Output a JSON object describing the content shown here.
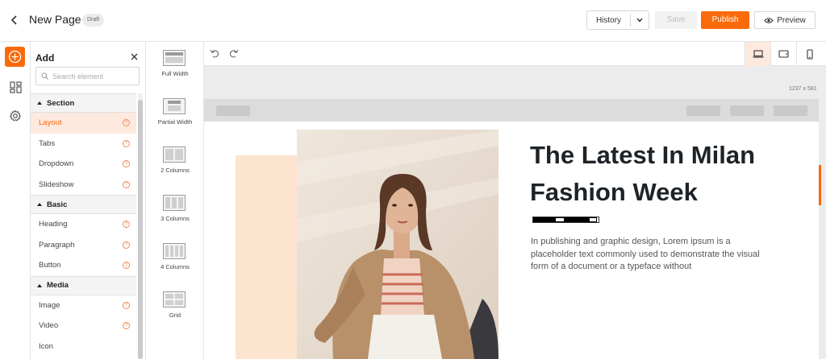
{
  "header": {
    "page_title": "New Page",
    "status_badge": "Draft",
    "history_label": "History",
    "save_label": "Save",
    "publish_label": "Publish",
    "preview_label": "Preview"
  },
  "rail": {
    "icons": [
      "add-circle-icon",
      "layout-grid-icon",
      "gear-icon"
    ]
  },
  "add_panel": {
    "title": "Add",
    "search_placeholder": "Search element",
    "categories": [
      {
        "label": "Section",
        "items": [
          "Layout",
          "Tabs",
          "Dropdown",
          "Slideshow"
        ]
      },
      {
        "label": "Basic",
        "items": [
          "Heading",
          "Paragraph",
          "Button"
        ]
      },
      {
        "label": "Media",
        "items": [
          "Image",
          "Video",
          "Icon"
        ]
      }
    ],
    "active_item": "Layout",
    "help_glyph": "?"
  },
  "layout_options": [
    "Full Width",
    "Partial Width",
    "2 Columns",
    "3 Columns",
    "4 Columns",
    "Grid"
  ],
  "canvas": {
    "size_readout": "1237 x 581",
    "devices": [
      "desktop-icon",
      "tablet-icon",
      "mobile-icon"
    ],
    "active_device": "desktop-icon"
  },
  "hero": {
    "title": "The Latest In Milan Fashion Week",
    "text": "In publishing and graphic design, Lorem ipsum is a placeholder text commonly used to demonstrate the visual form of a document or a typeface without"
  },
  "colors": {
    "accent": "#fa6a0a",
    "accent_light": "#fde9de",
    "peach": "#fde4cf"
  }
}
